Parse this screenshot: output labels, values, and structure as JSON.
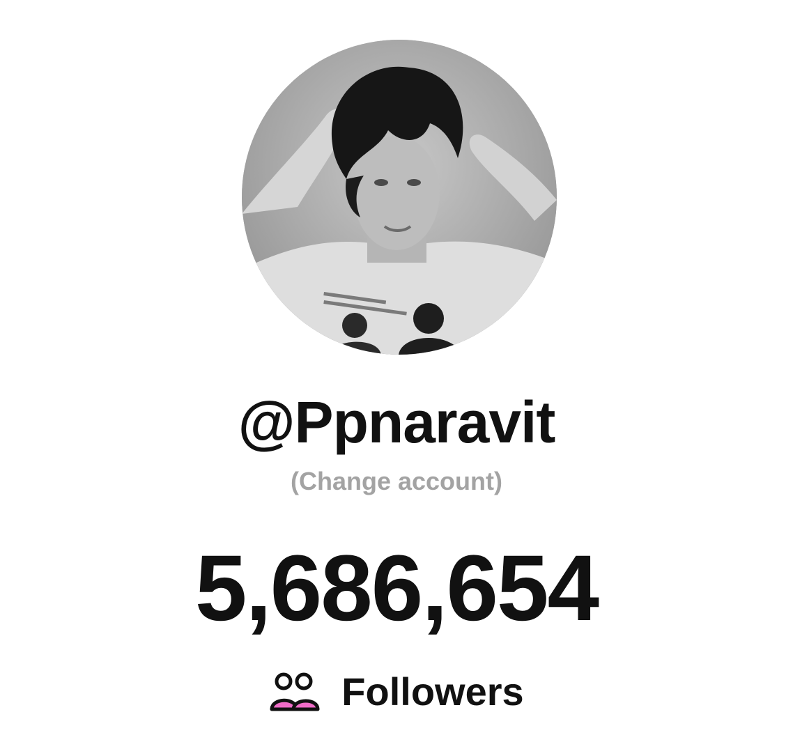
{
  "profile": {
    "username": "@Ppnaravit",
    "change_account_label": "(Change account)",
    "avatar_alt": "Profile photo",
    "follower_count": "5,686,654",
    "followers_label": "Followers"
  },
  "icons": {
    "followers": "people-icon"
  },
  "colors": {
    "text": "#111111",
    "muted": "#a3a3a3",
    "accent": "#f06cc8"
  }
}
